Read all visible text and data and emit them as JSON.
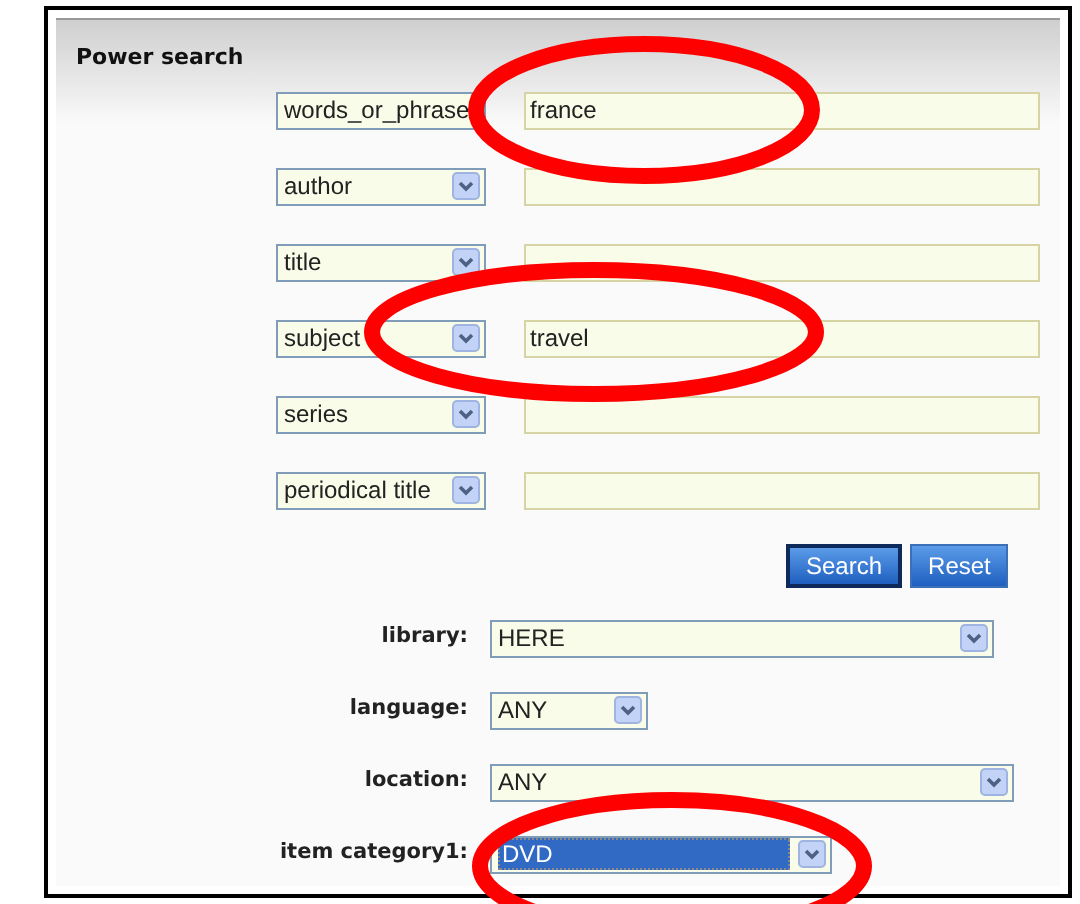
{
  "panel": {
    "title": "Power search"
  },
  "search_rows": [
    {
      "field": "words_or_phrase",
      "value": "france"
    },
    {
      "field": "author",
      "value": ""
    },
    {
      "field": "title",
      "value": ""
    },
    {
      "field": "subject",
      "value": "travel"
    },
    {
      "field": "series",
      "value": ""
    },
    {
      "field": "periodical title",
      "value": ""
    }
  ],
  "buttons": [
    "Search",
    "Reset"
  ],
  "filters": [
    {
      "label": "library:",
      "value": "HERE",
      "selected": false
    },
    {
      "label": "language:",
      "value": "ANY",
      "selected": false
    },
    {
      "label": "location:",
      "value": "ANY",
      "selected": false
    },
    {
      "label": "item category1:",
      "value": "DVD",
      "selected": true
    }
  ],
  "annotations": [
    {
      "kind": "ellipse"
    },
    {
      "kind": "ellipse"
    },
    {
      "kind": "ellipse"
    }
  ]
}
